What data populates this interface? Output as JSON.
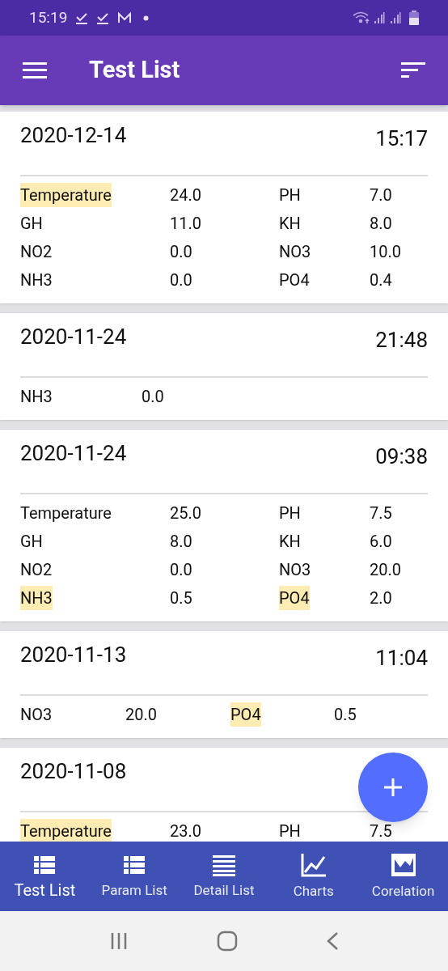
{
  "status_bar": {
    "time": "15:19"
  },
  "app_bar": {
    "title": "Test List"
  },
  "tests": [
    {
      "date": "2020-12-14",
      "time": "15:17",
      "kind": "full",
      "params": [
        {
          "name": "Temperature",
          "value": "24.0",
          "highlighted": true
        },
        {
          "name": "PH",
          "value": "7.0",
          "highlighted": false
        },
        {
          "name": "GH",
          "value": "11.0",
          "highlighted": false
        },
        {
          "name": "KH",
          "value": "8.0",
          "highlighted": false
        },
        {
          "name": "NO2",
          "value": "0.0",
          "highlighted": false
        },
        {
          "name": "NO3",
          "value": "10.0",
          "highlighted": false
        },
        {
          "name": "NH3",
          "value": "0.0",
          "highlighted": false
        },
        {
          "name": "PO4",
          "value": "0.4",
          "highlighted": false
        }
      ]
    },
    {
      "date": "2020-11-24",
      "time": "21:48",
      "kind": "compact",
      "params": [
        {
          "name": "NH3",
          "value": "0.0",
          "highlighted": false
        }
      ]
    },
    {
      "date": "2020-11-24",
      "time": "09:38",
      "kind": "full",
      "params": [
        {
          "name": "Temperature",
          "value": "25.0",
          "highlighted": false
        },
        {
          "name": "PH",
          "value": "7.5",
          "highlighted": false
        },
        {
          "name": "GH",
          "value": "8.0",
          "highlighted": false
        },
        {
          "name": "KH",
          "value": "6.0",
          "highlighted": false
        },
        {
          "name": "NO2",
          "value": "0.0",
          "highlighted": false
        },
        {
          "name": "NO3",
          "value": "20.0",
          "highlighted": false
        },
        {
          "name": "NH3",
          "value": "0.5",
          "highlighted": true
        },
        {
          "name": "PO4",
          "value": "2.0",
          "highlighted": true
        }
      ]
    },
    {
      "date": "2020-11-13",
      "time": "11:04",
      "kind": "compact",
      "params": [
        {
          "name": "NO3",
          "value": "20.0",
          "highlighted": false
        },
        {
          "name": "PO4",
          "value": "0.5",
          "highlighted": true
        }
      ]
    },
    {
      "date": "2020-11-08",
      "kind": "full",
      "params": [
        {
          "name": "Temperature",
          "value": "23.0",
          "highlighted": true
        },
        {
          "name": "PH",
          "value": "7.5",
          "highlighted": false
        }
      ]
    }
  ],
  "bottom_nav": [
    {
      "label": "Test List",
      "selected": true
    },
    {
      "label": "Param List",
      "selected": false
    },
    {
      "label": "Detail List",
      "selected": false
    },
    {
      "label": "Charts",
      "selected": false
    },
    {
      "label": "Corelation",
      "selected": false
    }
  ]
}
